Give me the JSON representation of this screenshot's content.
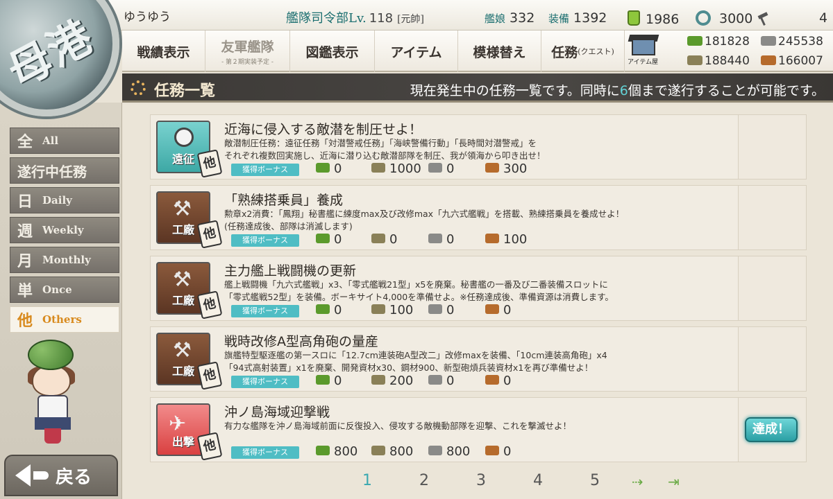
{
  "header": {
    "player_name": "ゆうゆう",
    "hq_label": "艦隊司令部Lv.",
    "hq_level": "118",
    "rank": "[元帥]",
    "ships_label": "艦娘",
    "ships_count": "332",
    "equip_label": "装備",
    "equip_count": "1392",
    "buckets": "1986",
    "dev_materials": "3000",
    "instant_build": "4"
  },
  "nav": {
    "items": [
      {
        "label": "戦績表示"
      },
      {
        "label": "友軍艦隊",
        "sub": "- 第２期実装予定 -"
      },
      {
        "label": "図鑑表示"
      },
      {
        "label": "アイテム"
      },
      {
        "label": "模様替え"
      },
      {
        "label": "任務",
        "small": "(クエスト)"
      }
    ],
    "shop_label": "アイテム屋"
  },
  "resources": {
    "fuel": "181828",
    "ammo": "188440",
    "steel": "245538",
    "bauxite": "166007"
  },
  "titlebar": {
    "title": "任務一覧",
    "info_pre": "現在発生中の任務一覧です。同時に",
    "info_num": "6",
    "info_post": "個まで遂行することが可能です。"
  },
  "sidebar": {
    "tabs": [
      {
        "kanji": "全",
        "en": "All"
      },
      {
        "kanji": "遂行中任務",
        "en": ""
      },
      {
        "kanji": "日",
        "en": "Daily"
      },
      {
        "kanji": "週",
        "en": "Weekly"
      },
      {
        "kanji": "月",
        "en": "Monthly"
      },
      {
        "kanji": "単",
        "en": "Once"
      },
      {
        "kanji": "他",
        "en": "Others"
      }
    ],
    "back_label": "戻る"
  },
  "quests": [
    {
      "category": "遠征",
      "type_badge": "他",
      "title": "近海に侵入する敵潜を制圧せよ！",
      "desc1": "敵潜制圧任務：遠征任務「対潜警戒任務」「海峡警備行動」「長時間対潜警戒」を",
      "desc2": "それぞれ複数回実施し、近海に潜り込む敵潜部隊を制圧、我が領海から叩き出せ！",
      "bonus_label": "獲得ボーナス",
      "fuel": "0",
      "ammo": "1000",
      "steel": "0",
      "bauxite": "300"
    },
    {
      "category": "工廠",
      "type_badge": "他",
      "title": "「熟練搭乗員」養成",
      "desc1": "勲章x2消費：「鳳翔」秘書艦に練度max及び改修max「九六式艦戦」を搭載、熟練搭乗員を養成せよ！",
      "desc2": "(任務達成後、部隊は消滅します)",
      "bonus_label": "獲得ボーナス",
      "fuel": "0",
      "ammo": "0",
      "steel": "0",
      "bauxite": "100"
    },
    {
      "category": "工廠",
      "type_badge": "他",
      "title": "主力艦上戦闘機の更新",
      "desc1": "艦上戦闘機「九六式艦戦」x3、「零式艦戦21型」x5を廃棄。秘書艦の一番及び二番装備スロットに",
      "desc2": "「零式艦戦52型」を装備。ボーキサイト4,000を準備せよ。※任務達成後、準備資源は消費します。",
      "bonus_label": "獲得ボーナス",
      "fuel": "0",
      "ammo": "100",
      "steel": "0",
      "bauxite": "0"
    },
    {
      "category": "工廠",
      "type_badge": "他",
      "title": "戦時改修A型高角砲の量産",
      "desc1": "旗艦特型駆逐艦の第一スロに「12.7cm連装砲A型改二」改修maxを装備、「10cm連装高角砲」x4",
      "desc2": "「94式高射装置」x1を廃棄、開発資材x30、鋼材900、新型砲熕兵装資材x1を再び準備せよ！",
      "bonus_label": "獲得ボーナス",
      "fuel": "0",
      "ammo": "200",
      "steel": "0",
      "bauxite": "0"
    },
    {
      "category": "出撃",
      "type_badge": "他",
      "title": "沖ノ島海域迎撃戦",
      "desc1": "有力な艦隊を沖ノ島海域前面に反復投入、侵攻する敵機動部隊を迎撃、これを撃滅せよ！",
      "desc2": "",
      "bonus_label": "獲得ボーナス",
      "fuel": "800",
      "ammo": "800",
      "steel": "800",
      "bauxite": "0",
      "achieved": "達成！"
    }
  ],
  "pagination": {
    "pages": [
      "1",
      "2",
      "3",
      "4",
      "5"
    ],
    "current": "1",
    "next": "⇢",
    "last": "⇥"
  },
  "emblem_text": "母港"
}
